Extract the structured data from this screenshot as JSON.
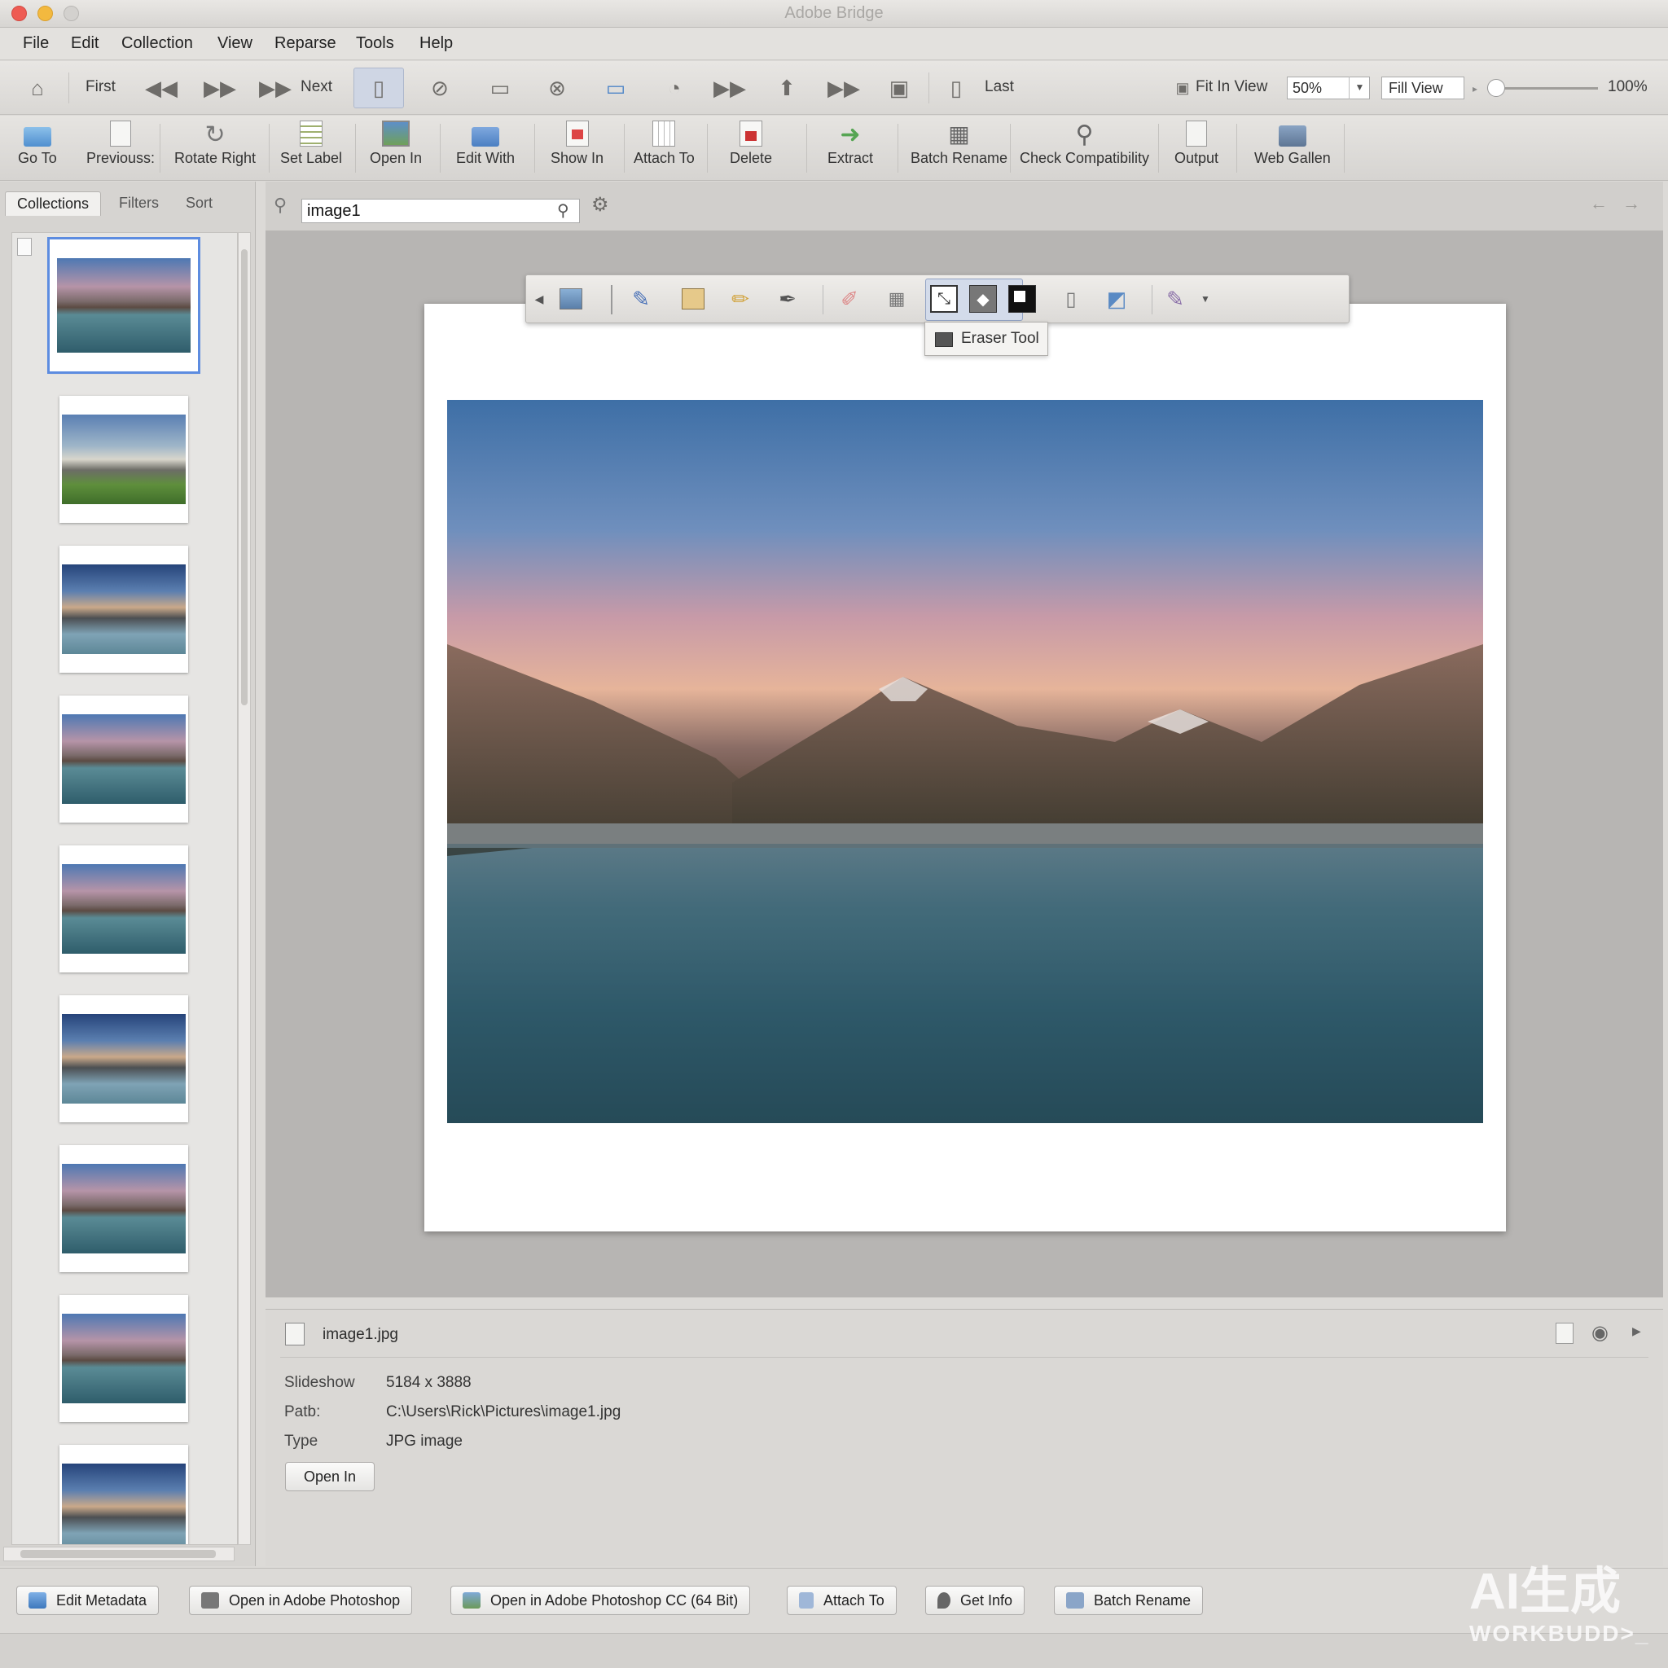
{
  "window": {
    "title": "Adobe Bridge"
  },
  "menu": [
    "File",
    "Edit",
    "Collection",
    "View",
    "Reparse",
    "Tools",
    "Help"
  ],
  "nav": {
    "first": "First",
    "next": "Next",
    "last": "Last",
    "fit_in_view": "Fit In View",
    "zoom": "50%",
    "fill_view": "Fill View",
    "zoom_max": "100%"
  },
  "toolbar": [
    "Go To",
    "Previouss:",
    "Rotate Right",
    "Set Label",
    "Open In",
    "Edit With",
    "Show In",
    "Attach To",
    "Delete",
    "Extract",
    "Batch Rename",
    "Check Compatibility",
    "Output",
    "Web Gallen"
  ],
  "left_panel": {
    "tabs": [
      "Collections",
      "Filters",
      "Sort"
    ],
    "active_tab": "Collections",
    "thumbnails": [
      "lake",
      "house",
      "pool",
      "lake",
      "lake",
      "pool",
      "lake",
      "lake",
      "pool"
    ]
  },
  "search": {
    "value": "image1"
  },
  "tooltip": {
    "label": "Eraser Tool"
  },
  "info": {
    "filename": "image1.jpg",
    "rows": [
      {
        "key": "Slideshow",
        "value": "5184 x 3888"
      },
      {
        "key": "Patb:",
        "value": "C:\\Users\\Rick\\Pictures\\image1.jpg"
      },
      {
        "key": "Type",
        "value": "JPG image"
      }
    ],
    "open_button": "Open In"
  },
  "bottom_buttons": [
    "Edit Metadata",
    "Open in Adobe Photoshop",
    "Open in Adobe Photoshop CC (64 Bit)",
    "Attach To",
    "Get Info",
    "Batch Rename"
  ],
  "watermark": {
    "line1": "AI生成",
    "line2": "WORKBUDD>_"
  },
  "colors": {
    "selection": "#5d8ce0",
    "close": "#ee5b53",
    "minimize": "#f3b93f"
  }
}
